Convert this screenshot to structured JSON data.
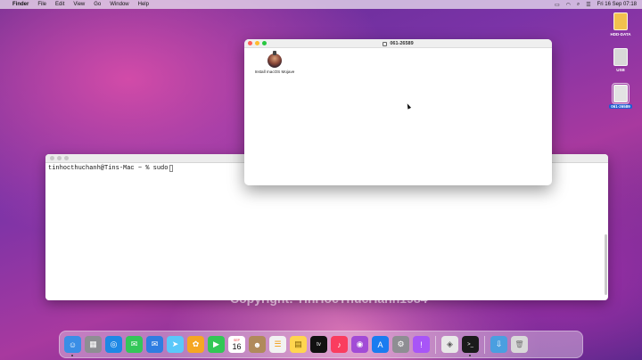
{
  "menubar": {
    "apple_glyph": "",
    "items": [
      "Finder",
      "File",
      "Edit",
      "View",
      "Go",
      "Window",
      "Help"
    ],
    "clock": "Fri 16 Sep  07:18"
  },
  "desktop": {
    "disks": [
      {
        "label": "HDD-DATA",
        "color": "#f2c14e"
      },
      {
        "label": "USB",
        "color": "#d8d8d8"
      },
      {
        "label": "061-26589",
        "color": "#e3e3e3"
      }
    ]
  },
  "terminal": {
    "prompt": "tinhocthuchanh@Tins-Mac ~ % sudo"
  },
  "finder": {
    "title": "061-26589",
    "app_label": "Install macOS Mojave"
  },
  "watermark": "Copyright: TinHocThucHanh1984",
  "dock": {
    "icons": [
      {
        "name": "finder",
        "color": "#3a8ee6",
        "glyph": "☺"
      },
      {
        "name": "launchpad",
        "color": "#8e8e93",
        "glyph": "▦"
      },
      {
        "name": "safari",
        "color": "#1e88e5",
        "glyph": "◎"
      },
      {
        "name": "messages",
        "color": "#34c759",
        "glyph": "✉"
      },
      {
        "name": "mail",
        "color": "#2f7de1",
        "glyph": "✉"
      },
      {
        "name": "maps",
        "color": "#5ac8fa",
        "glyph": "➤"
      },
      {
        "name": "photos",
        "color": "#f5a623",
        "glyph": "✿"
      },
      {
        "name": "facetime",
        "color": "#32c755",
        "glyph": "▶"
      },
      {
        "name": "calendar",
        "month": "SEP",
        "day": "16"
      },
      {
        "name": "contacts",
        "color": "#b08a5b",
        "glyph": "☻"
      },
      {
        "name": "reminders",
        "color": "#f2f2f2",
        "glyph": "☰"
      },
      {
        "name": "notes",
        "color": "#ffd54f",
        "glyph": "▤"
      },
      {
        "name": "tv",
        "color": "#111111",
        "glyph": "tv"
      },
      {
        "name": "music",
        "color": "#fa3d5f",
        "glyph": "♪"
      },
      {
        "name": "podcasts",
        "color": "#a24bd6",
        "glyph": "◉"
      },
      {
        "name": "app-store",
        "color": "#1a7cf0",
        "glyph": "A"
      },
      {
        "name": "system-preferences",
        "color": "#8e8e93",
        "glyph": "⚙"
      },
      {
        "name": "feedback",
        "color": "#a855f7",
        "glyph": "!"
      },
      {
        "name": "preview",
        "color": "#e8e8e8",
        "glyph": "◈"
      },
      {
        "name": "terminal",
        "color": "#1b1b1b",
        "glyph": ">_"
      },
      {
        "name": "downloads",
        "color": "#4a9fe0",
        "glyph": "⇩"
      },
      {
        "name": "trash",
        "color": "#d9d9d9",
        "glyph": "🗑"
      }
    ]
  }
}
